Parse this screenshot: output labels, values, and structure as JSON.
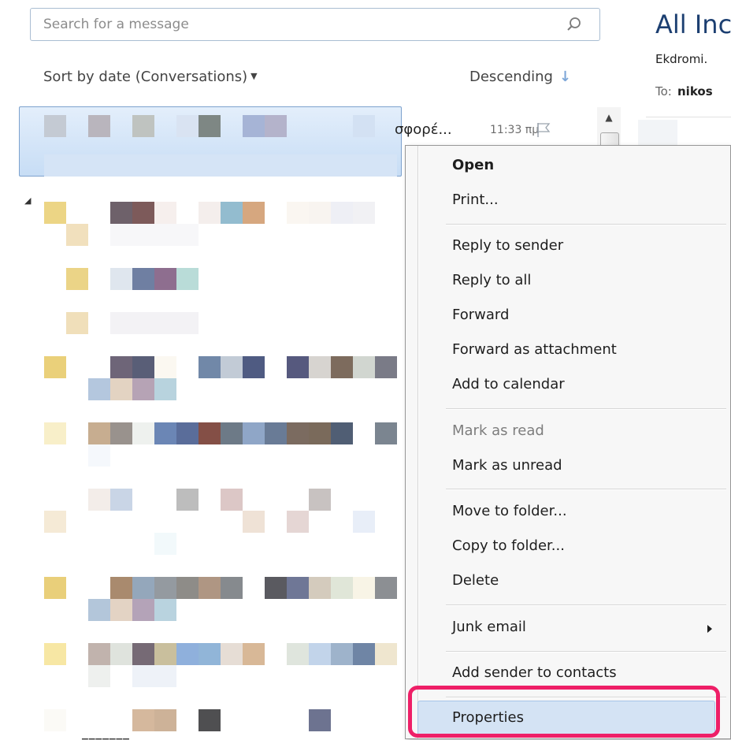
{
  "search": {
    "placeholder": "Search for a message",
    "icon": "search-icon"
  },
  "sort": {
    "by_label": "Sort by date (Conversations)",
    "order_label": "Descending"
  },
  "selected_message": {
    "subject_fragment": "σφορέ...",
    "time": "11:33 πμ"
  },
  "reading_pane": {
    "title": "All Inc",
    "from": "Ekdromi.",
    "to_label": "To:",
    "to_value": "nikos"
  },
  "context_menu": {
    "items": [
      {
        "label": "Open",
        "bold": true
      },
      {
        "label": "Print..."
      },
      {
        "label": "Reply to sender"
      },
      {
        "label": "Reply to all"
      },
      {
        "label": "Forward"
      },
      {
        "label": "Forward as attachment"
      },
      {
        "label": "Add to calendar"
      },
      {
        "label": "Mark as read",
        "disabled": true
      },
      {
        "label": "Mark as unread"
      },
      {
        "label": "Move to folder..."
      },
      {
        "label": "Copy to folder..."
      },
      {
        "label": "Delete"
      },
      {
        "label": "Junk email",
        "submenu": true
      },
      {
        "label": "Add sender to contacts"
      },
      {
        "label": "Properties",
        "highlighted": true
      }
    ]
  },
  "colors": {
    "highlight_annotation": "#ee1f67",
    "selection": "#c7ddf5",
    "menu_hover": "#d4e3f4"
  }
}
